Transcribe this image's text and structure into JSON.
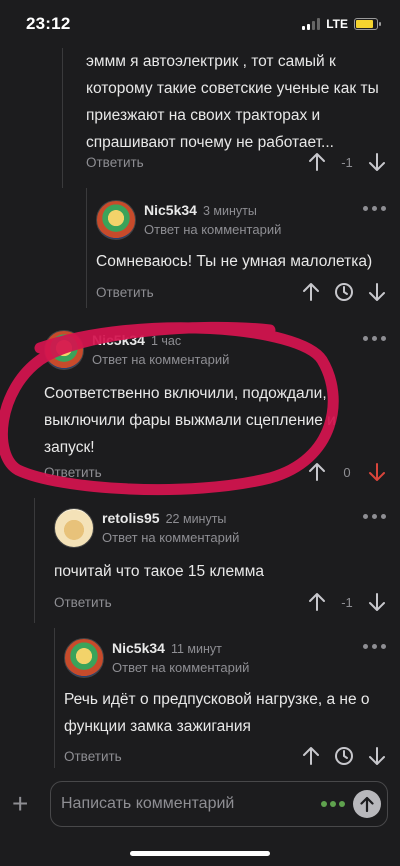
{
  "status_bar": {
    "time": "23:12",
    "network": "LTE"
  },
  "comments": [
    {
      "text": "эммм я автоэлектрик , тот самый к которому такие советские ученые как ты приезжают на своих тракторах и спрашивают почему не работает...",
      "reply": "Ответить",
      "score": "-1"
    },
    {
      "author": "Nic5k34",
      "time": "3 минуты",
      "reply_to": "Ответ на комментарий",
      "text": "Сомневаюсь! Ты не умная малолетка)",
      "reply": "Ответить"
    },
    {
      "author": "Nic5k34",
      "time": "1 час",
      "reply_to": "Ответ на комментарий",
      "text": "Соответственно включили, подождали, выключили фары выжмали сцепление и запуск!",
      "reply": "Ответить",
      "score": "0"
    },
    {
      "author": "retolis95",
      "time": "22 минуты",
      "reply_to": "Ответ на комментарий",
      "text": "почитай что такое 15 клемма",
      "reply": "Ответить",
      "score": "-1"
    },
    {
      "author": "Nic5k34",
      "time": "11 минут",
      "reply_to": "Ответ на комментарий",
      "text": "Речь идёт о предпусковой нагрузке, а не о функции замка зажигания",
      "reply": "Ответить"
    }
  ],
  "composer": {
    "placeholder": "Написать комментарий"
  },
  "colors": {
    "background": "#1c1c1e",
    "muted": "#8e8e93",
    "downvote_red": "#d9453b",
    "scribble": "#d4134f",
    "battery": "#f5d42f"
  },
  "icons": [
    "arrow-up-icon",
    "arrow-down-icon",
    "clock-icon",
    "more-dots-icon",
    "plus-icon",
    "send-icon"
  ]
}
